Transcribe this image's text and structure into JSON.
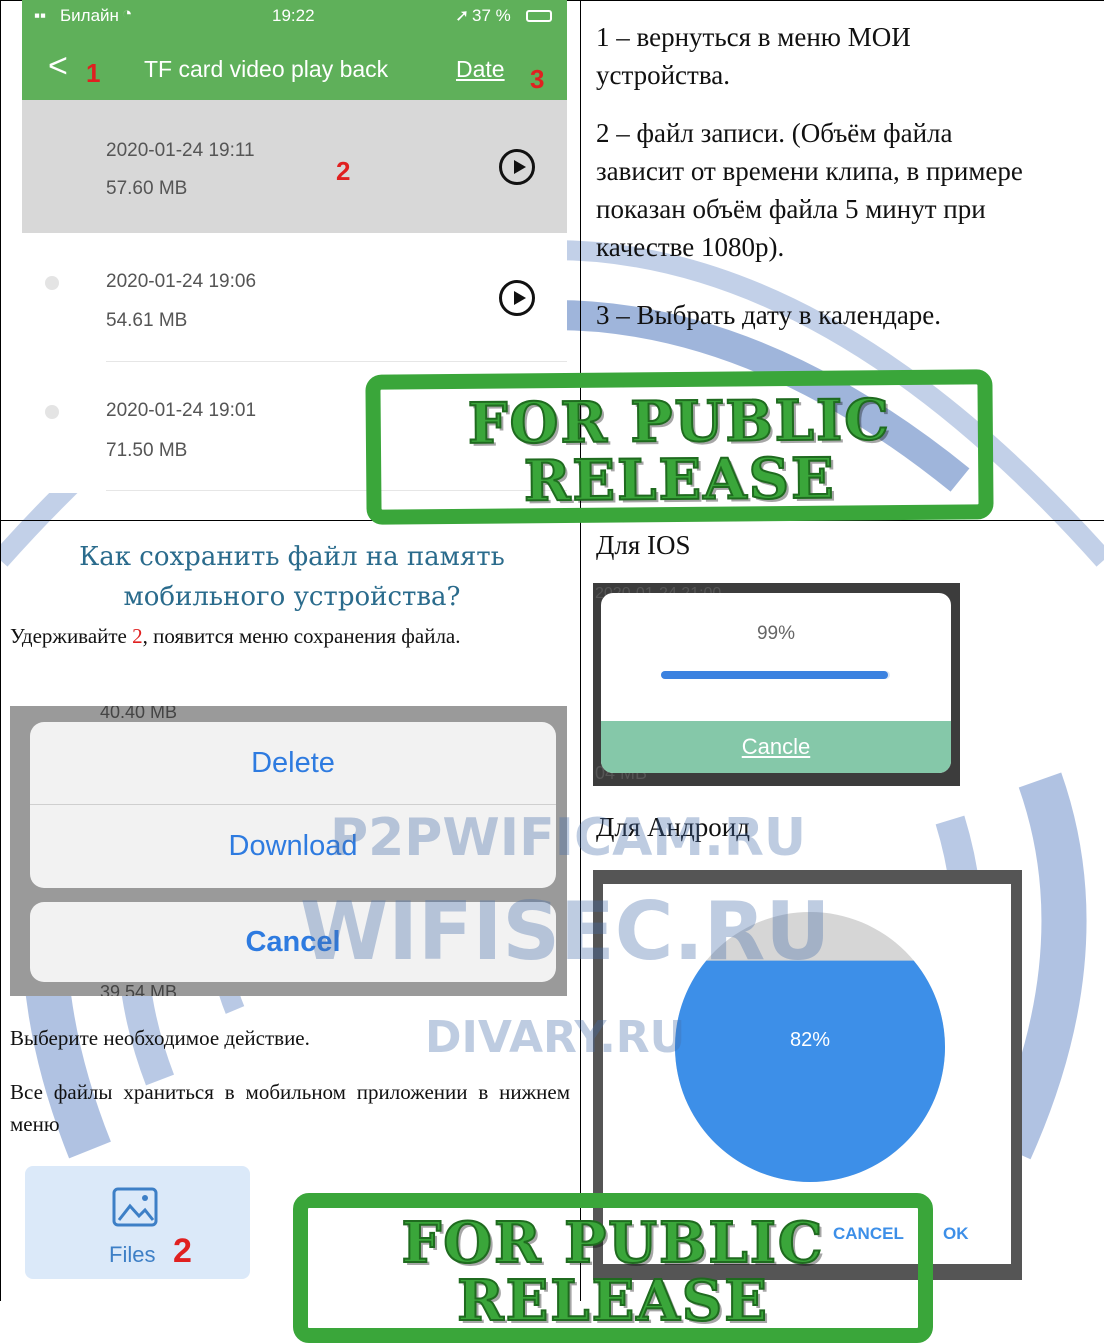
{
  "phone_top": {
    "status": {
      "carrier": "Билайн",
      "time": "19:22",
      "battery": "37 %"
    },
    "header": {
      "title": "TF card video play back",
      "date_label": "Date",
      "marker_back": "1",
      "marker_date": "3"
    },
    "files": [
      {
        "datetime": "2020-01-24 19:11",
        "size": "57.60 MB",
        "marker": "2"
      },
      {
        "datetime": "2020-01-24 19:06",
        "size": "54.61 MB"
      },
      {
        "datetime": "2020-01-24 19:01",
        "size": "71.50 MB"
      }
    ]
  },
  "legend": {
    "item1": "1 – вернуться в меню МОИ устройства.",
    "item2": "2 – файл записи. (Объём файла зависит от времени клипа, в примере показан объём файла 5 минут при качестве 1080р).",
    "item3": "3 – Выбрать дату в календаре."
  },
  "stamp": {
    "line1": "FOR PUBLIC",
    "line2": "RELEASE"
  },
  "section": {
    "heading": "Как сохранить файл на память мобильного устройства?",
    "hold_prefix": "Удерживайте ",
    "hold_num": "2",
    "hold_suffix": ", появится меню сохранения файла.",
    "choose": "Выберите необходимое действие.",
    "stored": "Все файлы храниться в мобильном приложении в нижнем меню"
  },
  "action_sheet": {
    "delete": "Delete",
    "download": "Download",
    "cancel": "Cancel",
    "peek_top": "40.40 MB",
    "peek_bottom": "39.54 MB"
  },
  "ios": {
    "label": "Для IOS",
    "percent": "99%",
    "progress": 0.99,
    "cancel": "Cancle",
    "peek_top": "2020-01-24 21:00",
    "peek_bottom": "04 MB"
  },
  "android": {
    "label": "Для Андроид",
    "percent": "82%",
    "progress": 0.82,
    "cancel": "CANCEL",
    "ok": "OK"
  },
  "files_tab": {
    "label": "Files",
    "marker": "2"
  },
  "watermarks": {
    "w1": "P2PWIFICAM.RU",
    "w2": "WIFISEC.RU",
    "w3": "DIVARY.RU"
  },
  "colors": {
    "header_green": "#5fb05a",
    "ios_bar": "#3b82e0",
    "ios_cancel_bg": "#85c8a9",
    "android_blue": "#3d8fe8",
    "stamp_green": "#3aa63a"
  }
}
